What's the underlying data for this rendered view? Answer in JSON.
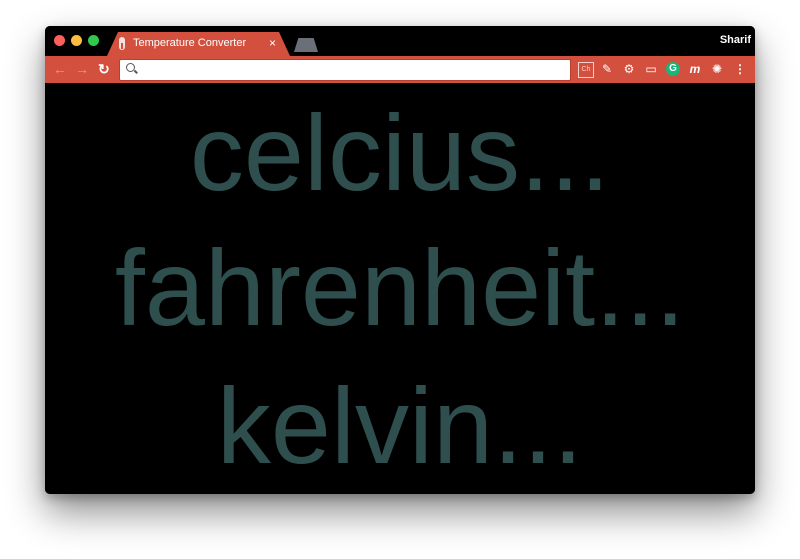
{
  "browser": {
    "tab_title": "Temperature Converter",
    "tab_close": "×",
    "profile_name": "Sharif",
    "omnibox_value": "",
    "accent_color": "#d4503e"
  },
  "toolbar": {
    "back_icon": "arrow-left-icon",
    "forward_icon": "arrow-right-icon",
    "reload_icon": "reload-icon",
    "extensions": [
      "ext-box-icon",
      "eyedropper-icon",
      "gear-icon",
      "window-icon",
      "grammarly-icon",
      "m-icon",
      "react-icon",
      "more-menu-icon"
    ]
  },
  "page": {
    "background": "#000000",
    "text_color": "#2f4f4f",
    "words": [
      "celcius...",
      "fahrenheit...",
      "kelvin..."
    ]
  }
}
